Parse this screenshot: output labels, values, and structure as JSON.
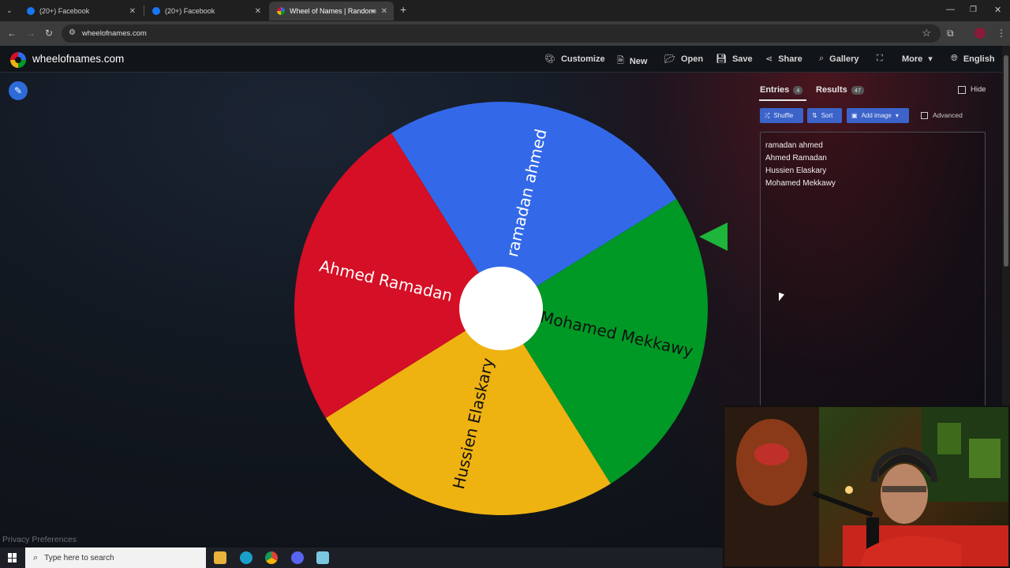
{
  "browser": {
    "tabs": [
      {
        "title": "(20+) Facebook"
      },
      {
        "title": "(20+) Facebook"
      },
      {
        "title": "Wheel of Names | Random"
      }
    ],
    "url": "wheelofnames.com"
  },
  "site": {
    "brand": "wheelofnames.com",
    "nav": {
      "customize": "Customize",
      "new": "New",
      "open": "Open",
      "save": "Save",
      "share": "Share",
      "gallery": "Gallery",
      "more": "More",
      "language": "English"
    }
  },
  "wheel": {
    "segments": [
      {
        "label": "ramadan ahmed",
        "color": "#3369e8"
      },
      {
        "label": "Mohamed Mekkawy",
        "color": "#009925"
      },
      {
        "label": "Hussien Elaskary",
        "color": "#eeb211"
      },
      {
        "label": "Ahmed Ramadan",
        "color": "#d50f25"
      }
    ]
  },
  "panel": {
    "entries_tab": "Entries",
    "entries_count": "4",
    "results_tab": "Results",
    "results_count": "47",
    "hide": "Hide",
    "shuffle": "Shuffle",
    "sort": "Sort",
    "add_image": "Add image",
    "advanced": "Advanced",
    "entries": [
      "ramadan ahmed",
      "Ahmed Ramadan",
      "Hussien Elaskary",
      "Mohamed Mekkawy"
    ]
  },
  "footer": {
    "privacy": "Privacy Preferences"
  },
  "taskbar": {
    "search_placeholder": "Type here to search"
  }
}
